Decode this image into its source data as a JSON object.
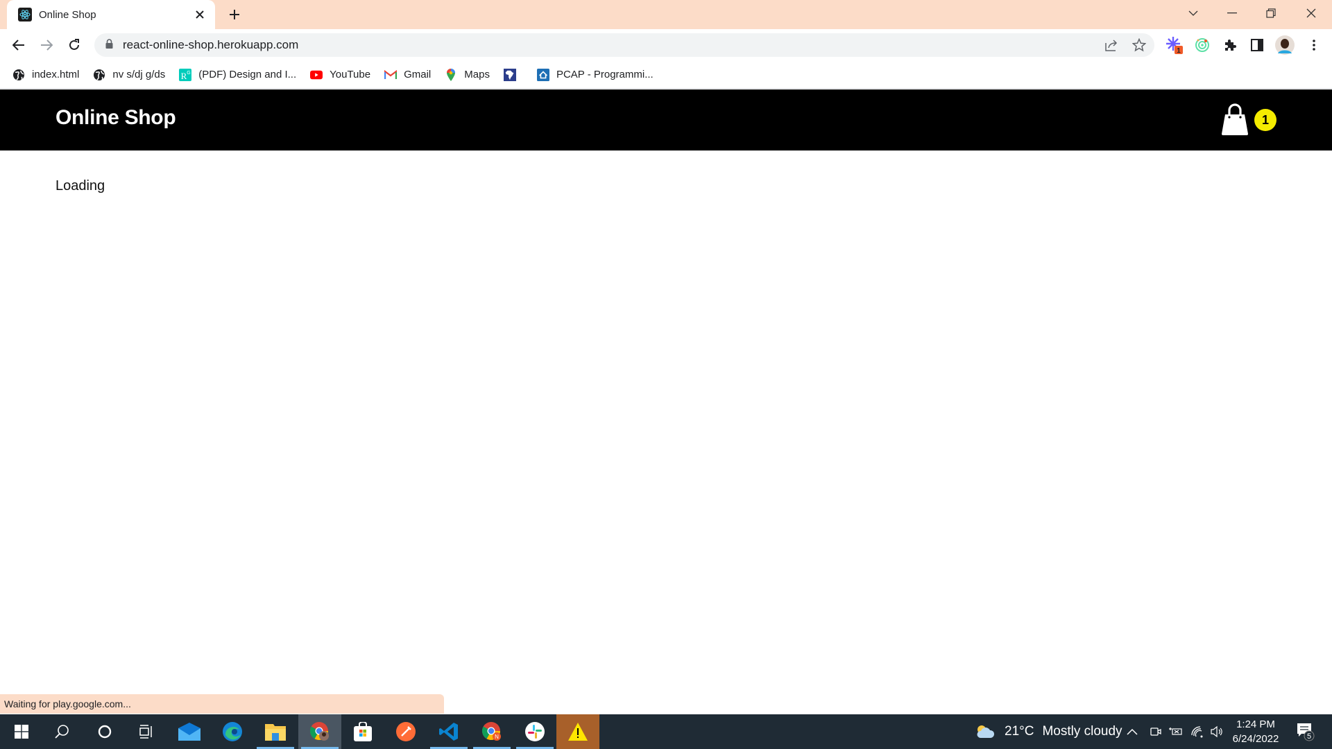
{
  "browser": {
    "tab": {
      "title": "Online Shop",
      "favicon": "react-icon"
    },
    "new_tab_label": "+",
    "url": "react-online-shop.herokuapp.com",
    "extensions": [
      {
        "name": "extension-asterisk",
        "badge": "1"
      },
      {
        "name": "extension-target"
      },
      {
        "name": "extensions-puzzle"
      },
      {
        "name": "side-panel"
      },
      {
        "name": "profile-avatar"
      },
      {
        "name": "chrome-menu"
      }
    ],
    "bookmarks": [
      {
        "label": "index.html",
        "icon": "globe-icon"
      },
      {
        "label": "nv s/dj g/ds",
        "icon": "globe-icon"
      },
      {
        "label": "(PDF) Design and I...",
        "icon": "researchgate-icon"
      },
      {
        "label": "YouTube",
        "icon": "youtube-icon"
      },
      {
        "label": "Gmail",
        "icon": "gmail-icon"
      },
      {
        "label": "Maps",
        "icon": "maps-icon"
      },
      {
        "label": "",
        "icon": "africa-map-icon"
      },
      {
        "label": "PCAP - Programmi...",
        "icon": "pcap-icon"
      }
    ],
    "status": "Waiting for play.google.com..."
  },
  "site": {
    "title": "Online Shop",
    "cart_count": "1",
    "loading_text": "Loading",
    "colors": {
      "header_bg": "#000000",
      "badge_bg": "#f5ec00"
    }
  },
  "taskbar": {
    "apps": [
      "start",
      "search",
      "cortana",
      "task-view",
      "mail",
      "edge",
      "file-explorer",
      "chrome-profile",
      "microsoft-store",
      "postman",
      "vscode",
      "chrome-n",
      "slack",
      "warning-app"
    ],
    "weather": {
      "temp": "21°C",
      "condition": "Mostly cloudy"
    },
    "time": "1:24 PM",
    "date": "6/24/2022",
    "notifications": "5"
  }
}
